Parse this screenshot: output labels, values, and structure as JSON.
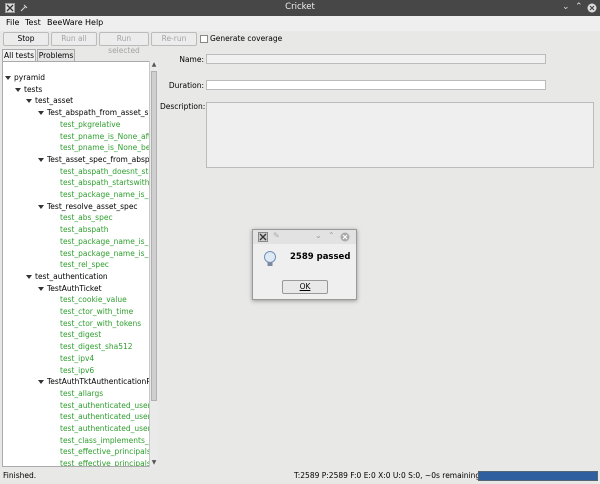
{
  "window": {
    "title": "Cricket"
  },
  "menu": [
    "File",
    "Test",
    "BeeWare",
    "Help"
  ],
  "toolbar": {
    "stop": "Stop",
    "run_all": "Run all",
    "run_selected": "Run selected",
    "rerun": "Re-run",
    "generate_coverage": "Generate coverage"
  },
  "tabs": [
    "All tests",
    "Problems"
  ],
  "tree": [
    {
      "label": "pyramid",
      "level": 0,
      "expanded": true,
      "pass": false
    },
    {
      "label": "tests",
      "level": 1,
      "expanded": true,
      "pass": false
    },
    {
      "label": "test_asset",
      "level": 2,
      "expanded": true,
      "pass": false
    },
    {
      "label": "Test_abspath_from_asset_sp",
      "level": 3,
      "expanded": true,
      "pass": false
    },
    {
      "label": "test_pkgrelative",
      "level": 4,
      "pass": true
    },
    {
      "label": "test_pname_is_None_afte",
      "level": 4,
      "pass": true
    },
    {
      "label": "test_pname_is_None_bef",
      "level": 4,
      "pass": true
    },
    {
      "label": "Test_asset_spec_from_abspa",
      "level": 3,
      "expanded": true,
      "pass": false
    },
    {
      "label": "test_abspath_doesnt_sta",
      "level": 4,
      "pass": true
    },
    {
      "label": "test_abspath_startswith_",
      "level": 4,
      "pass": true
    },
    {
      "label": "test_package_name_is_m",
      "level": 4,
      "pass": true
    },
    {
      "label": "Test_resolve_asset_spec",
      "level": 3,
      "expanded": true,
      "pass": false
    },
    {
      "label": "test_abs_spec",
      "level": 4,
      "pass": true
    },
    {
      "label": "test_abspath",
      "level": 4,
      "pass": true
    },
    {
      "label": "test_package_name_is_N",
      "level": 4,
      "pass": true
    },
    {
      "label": "test_package_name_is_p",
      "level": 4,
      "pass": true
    },
    {
      "label": "test_rel_spec",
      "level": 4,
      "pass": true
    },
    {
      "label": "test_authentication",
      "level": 2,
      "expanded": true,
      "pass": false
    },
    {
      "label": "TestAuthTicket",
      "level": 3,
      "expanded": true,
      "pass": false
    },
    {
      "label": "test_cookie_value",
      "level": 4,
      "pass": true
    },
    {
      "label": "test_ctor_with_time",
      "level": 4,
      "pass": true
    },
    {
      "label": "test_ctor_with_tokens",
      "level": 4,
      "pass": true
    },
    {
      "label": "test_digest",
      "level": 4,
      "pass": true
    },
    {
      "label": "test_digest_sha512",
      "level": 4,
      "pass": true
    },
    {
      "label": "test_ipv4",
      "level": 4,
      "pass": true
    },
    {
      "label": "test_ipv6",
      "level": 4,
      "pass": true
    },
    {
      "label": "TestAuthTktAuthenticationP",
      "level": 3,
      "expanded": true,
      "pass": false
    },
    {
      "label": "test_allargs",
      "level": 4,
      "pass": true
    },
    {
      "label": "test_authenticated_useri",
      "level": 4,
      "pass": true
    },
    {
      "label": "test_authenticated_useri",
      "level": 4,
      "pass": true
    },
    {
      "label": "test_authenticated_useri",
      "level": 4,
      "pass": true
    },
    {
      "label": "test_class_implements_l/",
      "level": 4,
      "pass": true
    },
    {
      "label": "test_effective_principals",
      "level": 4,
      "pass": true
    },
    {
      "label": "test_effective_principals",
      "level": 4,
      "pass": true
    }
  ],
  "details": {
    "name_label": "Name:",
    "duration_label": "Duration:",
    "description_label": "Description:",
    "name_value": "",
    "duration_value": "",
    "description_value": ""
  },
  "dialog": {
    "message": "2589 passed",
    "ok": "OK"
  },
  "status": {
    "left": "Finished.",
    "right": "T:2589 P:2589 F:0 E:0 X:0 U:0 S:0, ~0s remaining",
    "progress": 1.0
  },
  "colors": {
    "pass": "#2e9e2e",
    "titlebar": "#474747",
    "progress": "#2f5f9e"
  },
  "icons": [
    "app-icon",
    "pin-icon",
    "minimize-icon",
    "maximize-icon",
    "close-icon",
    "lightbulb-icon"
  ]
}
